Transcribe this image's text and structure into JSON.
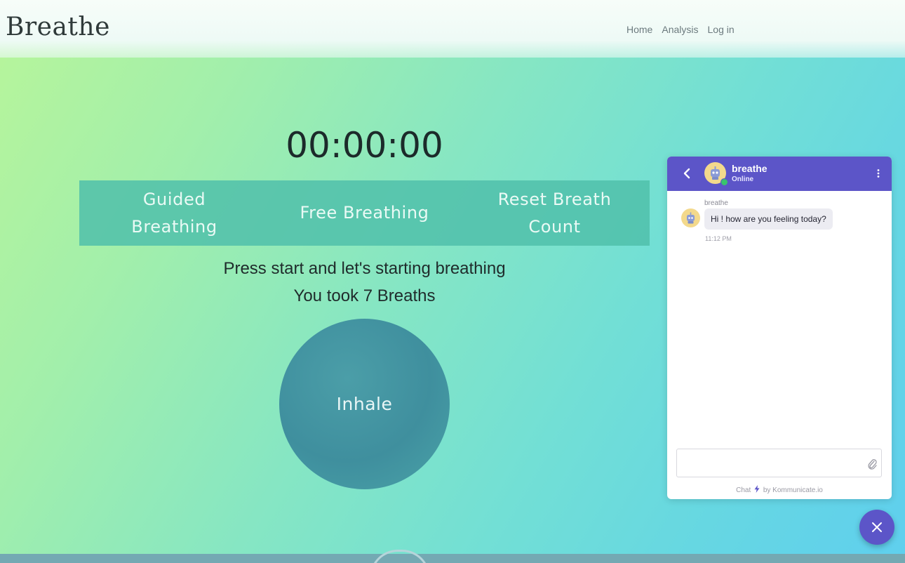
{
  "header": {
    "logo": "Breathe",
    "nav": [
      {
        "label": "Home"
      },
      {
        "label": "Analysis"
      },
      {
        "label": "Log in"
      }
    ]
  },
  "main": {
    "timer": "00:00:00",
    "modes": [
      {
        "label": "Guided Breathing"
      },
      {
        "label": "Free Breathing"
      },
      {
        "label": "Reset Breath Count"
      }
    ],
    "instruction": "Press start and let's starting breathing",
    "breath_count_text": "You took 7 Breaths",
    "circle_label": "Inhale"
  },
  "chat": {
    "bot_name": "breathe",
    "bot_status": "Online",
    "messages": [
      {
        "sender": "breathe",
        "text": "Hi ! how are you feeling today?",
        "time": "11:12 PM"
      }
    ],
    "input_value": "",
    "footer": {
      "prefix": "Chat",
      "suffix": "by Kommunicate.io"
    },
    "accent_color": "#5c55c8",
    "icons": [
      "back-arrow-icon",
      "bot-avatar-icon",
      "more-vertical-icon",
      "paperclip-icon",
      "bolt-icon",
      "close-icon"
    ]
  },
  "colors": {
    "mode_bar": "#50c0aa",
    "circle": "#3f8f9e",
    "online": "#39c46d"
  }
}
